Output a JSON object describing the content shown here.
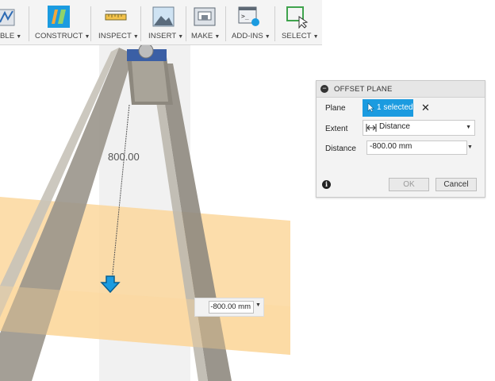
{
  "toolbar": {
    "items": [
      {
        "label": "BLE",
        "icon": "sketch-tools-icon"
      },
      {
        "label": "CONSTRUCT",
        "icon": "construct-plane-icon"
      },
      {
        "label": "INSPECT",
        "icon": "measure-ruler-icon"
      },
      {
        "label": "INSERT",
        "icon": "insert-image-icon"
      },
      {
        "label": "MAKE",
        "icon": "3d-print-icon"
      },
      {
        "label": "ADD-INS",
        "icon": "scripts-addins-icon"
      },
      {
        "label": "SELECT",
        "icon": "select-window-icon"
      }
    ],
    "caret": "▼",
    "accent": "#1b9be0"
  },
  "viewport": {
    "dimension_label": "800.00",
    "dimension_input": "-800.00 mm",
    "plane_color": "#fbd79c",
    "model_color": "#8f8a80"
  },
  "dialog": {
    "collapse_symbol": "−",
    "title": "OFFSET PLANE",
    "plane_label": "Plane",
    "selected_text": "1 selected",
    "clear_symbol": "✕",
    "extent_label": "Extent",
    "extent_value": "Distance",
    "distance_label": "Distance",
    "distance_value": "-800.00 mm",
    "info_symbol": "i",
    "ok_label": "OK",
    "cancel_label": "Cancel"
  }
}
